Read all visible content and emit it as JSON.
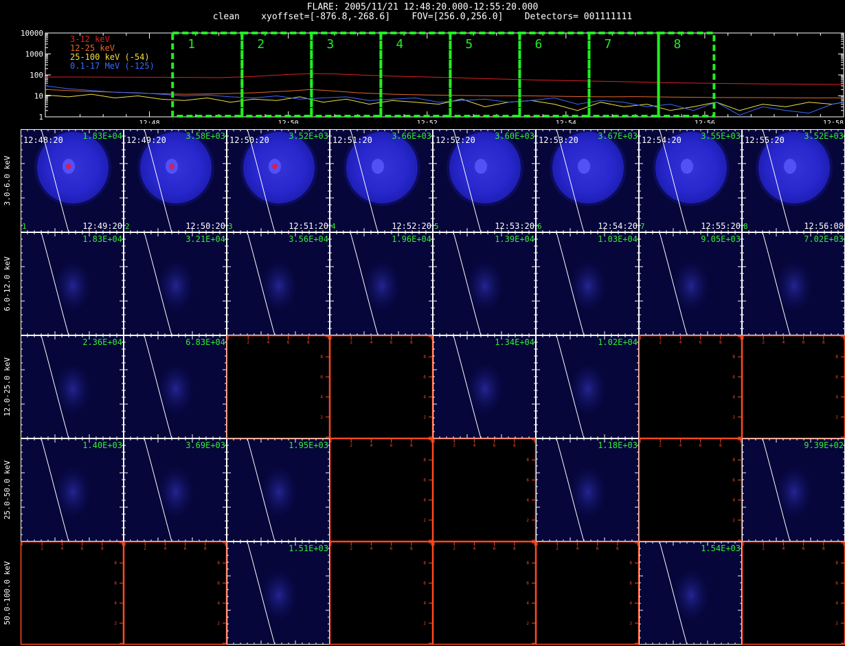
{
  "header": {
    "title": "FLARE: 2005/11/21 12:48:20.000-12:55:20.000",
    "subtitle": "clean    xyoffset=[-876.8,-268.6]    FOV=[256.0,256.0]    Detectors= 001111111"
  },
  "colors": {
    "background": "#000000",
    "axes": "#ffffff",
    "empty_panel_axes": "#ff4a20",
    "interval_boxes": "#22ee22",
    "flux_label": "#33ee33",
    "image_bg": "#06063a",
    "limb": "#ffffff"
  },
  "chart_data": [
    {
      "type": "line",
      "yscale": "log",
      "ylim": [
        1,
        10000
      ],
      "xlim": [
        "12:46:30",
        "12:58:00"
      ],
      "y_ticks": [
        "1",
        "10",
        "100",
        "1000",
        "10000"
      ],
      "x_ticks": [
        "12:48",
        "12:50",
        "12:52",
        "12:54",
        "12:56",
        "12:58"
      ],
      "grid": false,
      "legend_position": "top-left",
      "intervals": [
        {
          "label": "1",
          "start": "12:48:20",
          "end": "12:49:20"
        },
        {
          "label": "2",
          "start": "12:49:20",
          "end": "12:50:20"
        },
        {
          "label": "3",
          "start": "12:50:20",
          "end": "12:51:20"
        },
        {
          "label": "4",
          "start": "12:51:20",
          "end": "12:52:20"
        },
        {
          "label": "5",
          "start": "12:52:20",
          "end": "12:53:20"
        },
        {
          "label": "6",
          "start": "12:53:20",
          "end": "12:54:20"
        },
        {
          "label": "7",
          "start": "12:54:20",
          "end": "12:55:20"
        },
        {
          "label": "8",
          "start": "12:55:20",
          "end": "12:56:08"
        }
      ],
      "series": [
        {
          "name": "3-12 keV",
          "color": "#e02020",
          "x": [
            "12:46:30",
            "12:47:30",
            "12:48:30",
            "12:49:00",
            "12:49:30",
            "12:50:00",
            "12:50:20",
            "12:50:40",
            "12:51:00",
            "12:51:30",
            "12:52:00",
            "12:52:30",
            "12:53:00",
            "12:53:30",
            "12:54:00",
            "12:54:30",
            "12:55:00",
            "12:55:30",
            "12:56:00",
            "12:56:30",
            "12:57:00",
            "12:57:30",
            "12:58:00"
          ],
          "values": [
            80,
            78,
            76,
            74,
            85,
            105,
            115,
            112,
            100,
            88,
            80,
            72,
            64,
            58,
            54,
            50,
            46,
            42,
            40,
            38,
            37,
            36,
            35
          ]
        },
        {
          "name": "12-25 keV",
          "color": "#e8682a",
          "x": [
            "12:46:30",
            "12:47:00",
            "12:47:30",
            "12:48:00",
            "12:48:30",
            "12:49:00",
            "12:49:30",
            "12:50:00",
            "12:50:20",
            "12:50:40",
            "12:51:00",
            "12:51:30",
            "12:52:00",
            "12:52:30",
            "12:53:00",
            "12:53:30",
            "12:54:00",
            "12:54:30",
            "12:55:00",
            "12:55:30",
            "12:56:00",
            "12:56:30",
            "12:57:00",
            "12:57:30",
            "12:58:00"
          ],
          "values": [
            20,
            17,
            15,
            13,
            12,
            12.5,
            14,
            17,
            20,
            17,
            14,
            12,
            11,
            10.5,
            10,
            10,
            9.5,
            9,
            9.2,
            8.8,
            8.5,
            8.3,
            8.2,
            8,
            8
          ]
        },
        {
          "name": "25-100 keV (-54)",
          "color": "#f0e040",
          "x": [
            "12:46:30",
            "12:46:50",
            "12:47:10",
            "12:47:30",
            "12:47:50",
            "12:48:10",
            "12:48:30",
            "12:48:50",
            "12:49:10",
            "12:49:30",
            "12:49:50",
            "12:50:10",
            "12:50:30",
            "12:50:50",
            "12:51:10",
            "12:51:30",
            "12:51:50",
            "12:52:10",
            "12:52:30",
            "12:52:50",
            "12:53:10",
            "12:53:30",
            "12:53:50",
            "12:54:10",
            "12:54:30",
            "12:54:50",
            "12:55:10",
            "12:55:30",
            "12:55:50",
            "12:56:10",
            "12:56:30",
            "12:56:50",
            "12:57:10",
            "12:57:30",
            "12:57:50",
            "12:58:00"
          ],
          "values": [
            11,
            9,
            12,
            8,
            10,
            7,
            6,
            8,
            5,
            7,
            6,
            9,
            5,
            7,
            4,
            6,
            5,
            4,
            7,
            3,
            5,
            6,
            4,
            2,
            5,
            3,
            4,
            2,
            3,
            5,
            2,
            4,
            3,
            5,
            4,
            5
          ]
        },
        {
          "name": "0.1-17 MeV (-125)",
          "color": "#3a6aff",
          "x": [
            "12:46:30",
            "12:46:50",
            "12:47:10",
            "12:47:30",
            "12:47:50",
            "12:48:10",
            "12:48:30",
            "12:48:50",
            "12:49:10",
            "12:49:30",
            "12:49:50",
            "12:50:10",
            "12:50:30",
            "12:50:50",
            "12:51:10",
            "12:51:30",
            "12:51:50",
            "12:52:10",
            "12:52:30",
            "12:52:50",
            "12:53:10",
            "12:53:30",
            "12:53:50",
            "12:54:10",
            "12:54:30",
            "12:54:50",
            "12:55:10",
            "12:55:30",
            "12:55:50",
            "12:56:10",
            "12:56:30",
            "12:56:50",
            "12:57:10",
            "12:57:30",
            "12:57:50",
            "12:58:00"
          ],
          "values": [
            30,
            22,
            18,
            15,
            14,
            12,
            10,
            11,
            9,
            8,
            10,
            7,
            8,
            9,
            6,
            7,
            8,
            5,
            6,
            7,
            5,
            6,
            8,
            4,
            6,
            5,
            3,
            4,
            2,
            5,
            1.2,
            3,
            2,
            1.5,
            4,
            5
          ]
        }
      ]
    },
    {
      "type": "heatmap",
      "columns": [
        {
          "index": "1",
          "start": "12:48:20",
          "end": "12:49:20"
        },
        {
          "index": "2",
          "start": "12:49:20",
          "end": "12:50:20"
        },
        {
          "index": "3",
          "start": "12:50:20",
          "end": "12:51:20"
        },
        {
          "index": "4",
          "start": "12:51:20",
          "end": "12:52:20"
        },
        {
          "index": "5",
          "start": "12:52:20",
          "end": "12:53:20"
        },
        {
          "index": "6",
          "start": "12:53:20",
          "end": "12:54:20"
        },
        {
          "index": "7",
          "start": "12:54:20",
          "end": "12:55:20"
        },
        {
          "index": "8",
          "start": "12:55:20",
          "end": "12:56:08"
        }
      ],
      "rows": [
        {
          "label": "3.0-6.0 keV",
          "fluxes": [
            "1.83E+04",
            "3.58E+03",
            "3.52E+03",
            "3.66E+03",
            "3.60E+03",
            "3.67E+03",
            "3.55E+03",
            "3.52E+03"
          ],
          "kinds": [
            "disk",
            "disk",
            "disk",
            "disk",
            "disk",
            "disk",
            "disk",
            "disk"
          ]
        },
        {
          "label": "6.0-12.0 keV",
          "fluxes": [
            "1.83E+04",
            "3.21E+04",
            "3.56E+04",
            "1.96E+04",
            "1.39E+04",
            "1.03E+04",
            "9.05E+03",
            "7.02E+03"
          ],
          "kinds": [
            "image",
            "image",
            "image",
            "image",
            "image",
            "image",
            "image",
            "image"
          ]
        },
        {
          "label": "12.0-25.0 keV",
          "fluxes": [
            "2.36E+04",
            "6.83E+04",
            "",
            "",
            "1.34E+04",
            "1.02E+04",
            "",
            ""
          ],
          "kinds": [
            "image",
            "image",
            "empty",
            "empty",
            "image",
            "image",
            "empty",
            "empty"
          ]
        },
        {
          "label": "25.0-50.0 keV",
          "fluxes": [
            "1.40E+03",
            "3.69E+03",
            "1.95E+03",
            "",
            "",
            "1.18E+03",
            "",
            "9.39E+02"
          ],
          "kinds": [
            "image",
            "image",
            "image",
            "empty",
            "empty",
            "image",
            "empty",
            "image"
          ]
        },
        {
          "label": "50.0-100.0 keV",
          "fluxes": [
            "",
            "",
            "1.51E+03",
            "",
            "",
            "",
            "1.54E+03",
            ""
          ],
          "kinds": [
            "empty",
            "empty",
            "image",
            "empty",
            "empty",
            "empty",
            "image",
            "empty"
          ]
        }
      ],
      "empty_axis_ticks": [
        "0",
        "2",
        "4",
        "6",
        "8",
        "10"
      ]
    }
  ]
}
